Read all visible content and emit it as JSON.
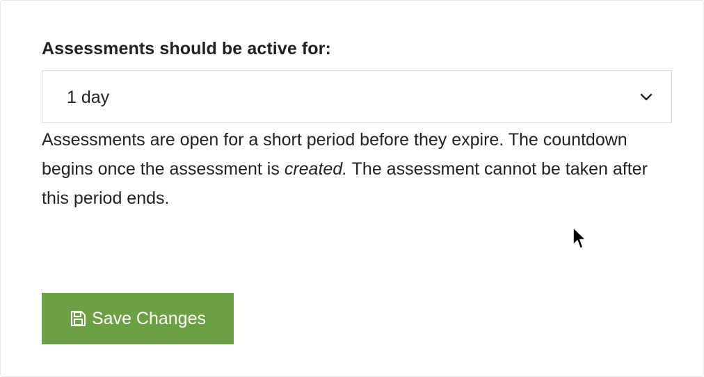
{
  "form": {
    "label": "Assessments should be active for:",
    "duration_value": "1 day",
    "help_part1": "Assessments are open for a short period before they expire. The countdown begins once the assessment is ",
    "help_emphasis": "created.",
    "help_part2": " The assessment cannot be taken after this period ends."
  },
  "actions": {
    "save_label": "Save Changes"
  },
  "icons": {
    "dropdown": "chevron-down-icon",
    "save": "floppy-disk-icon",
    "cursor": "mouse-pointer-icon"
  },
  "colors": {
    "save_button": "#6ba142",
    "text": "#222222",
    "border": "#dcdcdc"
  }
}
